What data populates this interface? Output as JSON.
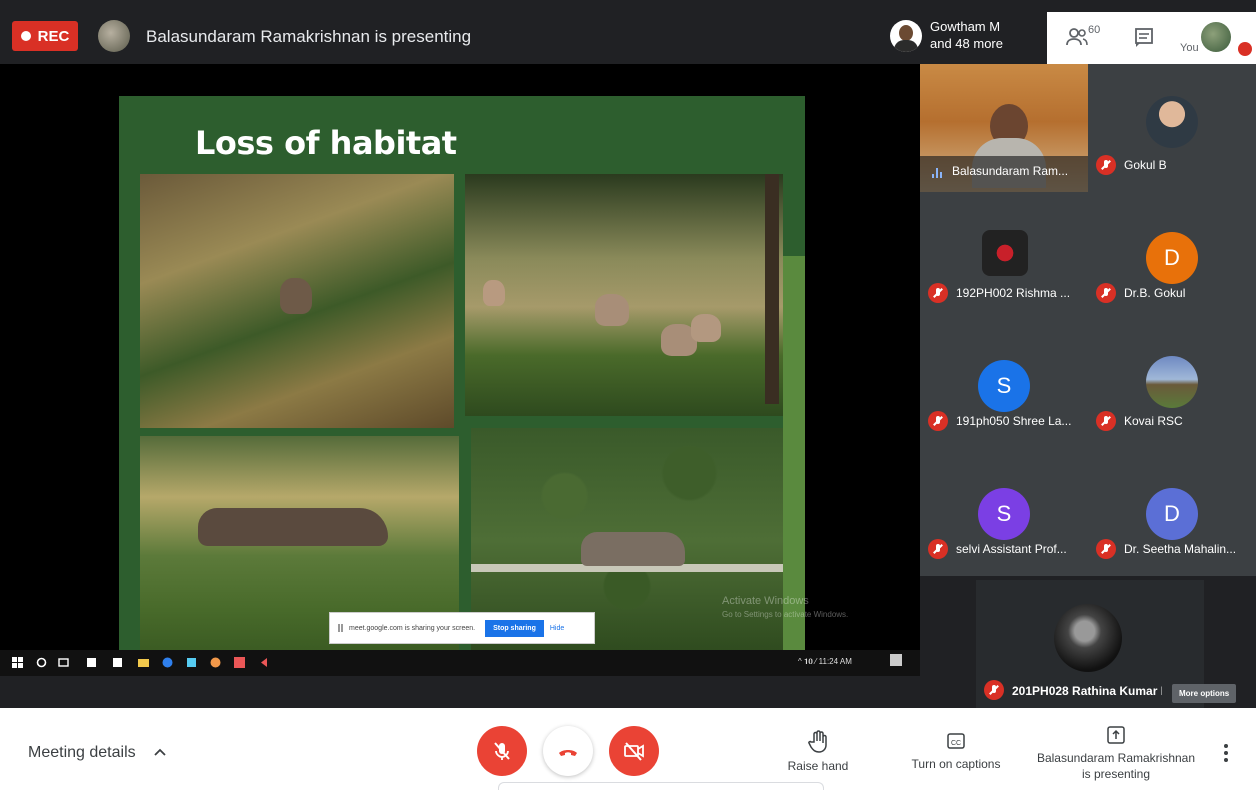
{
  "topbar": {
    "rec_label": "REC",
    "presenting_status": "Balasundaram Ramakrishnan is presenting",
    "guest_name_line1": "Gowtham M",
    "guest_name_line2": "and 48 more",
    "people_count": "60",
    "you_label": "You"
  },
  "slide": {
    "title": "Loss of habitat"
  },
  "screen_share_bar": {
    "message": "meet.google.com is sharing your screen.",
    "stop_label": "Stop sharing",
    "hide_label": "Hide"
  },
  "taskbar": {
    "tray_text": "^ 𝟏𝟎 ⁄ 11:24 AM"
  },
  "watermark": {
    "line1": "Activate Windows",
    "line2": "Go to Settings to activate Windows."
  },
  "participants": [
    {
      "name": "Balasundaram Ram..."
    },
    {
      "name": "Gokul B"
    },
    {
      "name": "192PH002 Rishma ..."
    },
    {
      "name": "Dr.B. Gokul",
      "initial": "D"
    },
    {
      "name": "191ph050 Shree La...",
      "initial": "S"
    },
    {
      "name": "Kovai RSC"
    },
    {
      "name": "selvi Assistant Prof...",
      "initial": "S"
    },
    {
      "name": "Dr. Seetha Mahalin...",
      "initial": "D"
    },
    {
      "name": "201PH028 Rathina Kumar B"
    }
  ],
  "more_options_tooltip": "More options",
  "bottombar": {
    "meeting_details_label": "Meeting details",
    "raise_hand_label": "Raise hand",
    "captions_label": "Turn on captions",
    "presenting_line1": "Balasundaram Ramakrishnan",
    "presenting_line2": "is presenting"
  },
  "colors": {
    "rec_red": "#d93025",
    "end_call_red": "#ea4335",
    "slide_green": "#2d5e2e",
    "avatar_orange": "#e8710a",
    "avatar_blue": "#1a73e8",
    "avatar_purple": "#7b3fe4",
    "avatar_indigo": "#5b6fd6"
  }
}
